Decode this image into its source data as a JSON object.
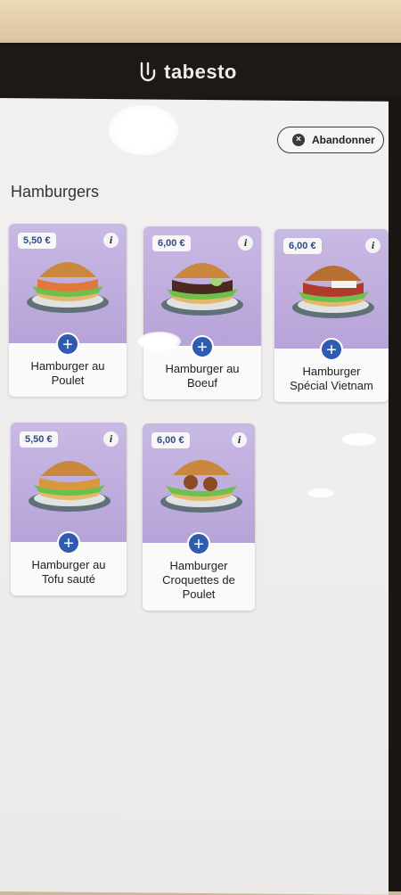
{
  "header": {
    "brand": "tabesto"
  },
  "abandon_button": {
    "label": "Abandonner"
  },
  "section": {
    "title": "Hamburgers"
  },
  "products": [
    {
      "name_line1": "Hamburger au",
      "name_line2": "Poulet",
      "name_line3": "",
      "price": "5,50 €"
    },
    {
      "name_line1": "Hamburger au",
      "name_line2": "Boeuf",
      "name_line3": "",
      "price": "6,00 €"
    },
    {
      "name_line1": "Hamburger",
      "name_line2": "Spécial Vietnam",
      "name_line3": "",
      "price": "6,00 €"
    },
    {
      "name_line1": "Hamburger au",
      "name_line2": "Tofu sauté",
      "name_line3": "",
      "price": "5,50 €"
    },
    {
      "name_line1": "Hamburger",
      "name_line2": "Croquettes de",
      "name_line3": "Poulet",
      "price": "6,00 €"
    }
  ],
  "icons": {
    "info": "i",
    "add": "+",
    "close": "×"
  },
  "colors": {
    "accent": "#2f5bb0",
    "card_bg": "#b7a3d8",
    "price_text": "#2f4b83"
  }
}
